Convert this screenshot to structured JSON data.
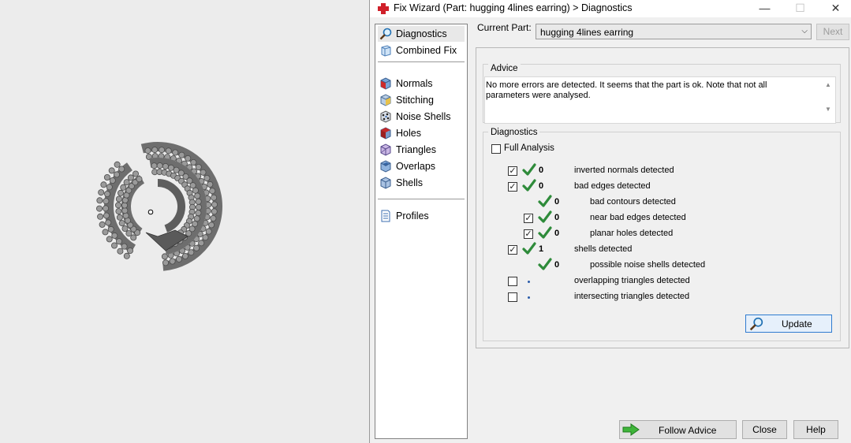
{
  "window": {
    "title": "Fix Wizard (Part: hugging 4lines earring) > Diagnostics",
    "minimize_glyph": "—",
    "maximize_glyph": "☐",
    "close_glyph": "✕"
  },
  "nav": {
    "items": [
      {
        "label": "Diagnostics",
        "icon": "magnifier-icon"
      },
      {
        "label": "Combined Fix",
        "icon": "combined-fix-icon"
      },
      {
        "label": "Normals",
        "icon": "normals-cube-icon"
      },
      {
        "label": "Stitching",
        "icon": "stitching-cube-icon"
      },
      {
        "label": "Noise Shells",
        "icon": "noise-shells-icon"
      },
      {
        "label": "Holes",
        "icon": "holes-cube-icon"
      },
      {
        "label": "Triangles",
        "icon": "triangles-cube-icon"
      },
      {
        "label": "Overlaps",
        "icon": "overlaps-cube-icon"
      },
      {
        "label": "Shells",
        "icon": "shells-cube-icon"
      },
      {
        "label": "Profiles",
        "icon": "profiles-doc-icon"
      }
    ]
  },
  "header": {
    "current_part_label": "Current Part:",
    "current_part_value": "hugging 4lines earring",
    "next_label": "Next"
  },
  "advice": {
    "title": "Advice",
    "text": "No more errors are detected. It seems that the part is ok. Note that not all parameters were analysed."
  },
  "diagnostics": {
    "title": "Diagnostics",
    "full_analysis_label": "Full Analysis",
    "full_analysis_checked": false,
    "rows": [
      {
        "checked": true,
        "status": "ok",
        "count": "0",
        "label": "inverted normals detected",
        "indent": 0
      },
      {
        "checked": true,
        "status": "ok",
        "count": "0",
        "label": "bad edges detected",
        "indent": 0
      },
      {
        "checked": null,
        "status": "ok",
        "count": "0",
        "label": "bad contours detected",
        "indent": 1
      },
      {
        "checked": true,
        "status": "ok",
        "count": "0",
        "label": "near bad edges detected",
        "indent": 1
      },
      {
        "checked": true,
        "status": "ok",
        "count": "0",
        "label": "planar holes detected",
        "indent": 1
      },
      {
        "checked": true,
        "status": "ok",
        "count": "1",
        "label": "shells detected",
        "indent": 0
      },
      {
        "checked": null,
        "status": "ok",
        "count": "0",
        "label": "possible noise shells detected",
        "indent": 1
      },
      {
        "checked": false,
        "status": "pending",
        "count": "",
        "label": "overlapping triangles detected",
        "indent": 0
      },
      {
        "checked": false,
        "status": "pending",
        "count": "",
        "label": "intersecting triangles detected",
        "indent": 0
      }
    ],
    "update_label": "Update"
  },
  "footer": {
    "follow_advice_label": "Follow Advice",
    "close_label": "Close",
    "help_label": "Help"
  },
  "colors": {
    "check_green": "#2e8b3a",
    "selection_border": "#2f7bd0",
    "title_icon_red": "#d0202a"
  }
}
